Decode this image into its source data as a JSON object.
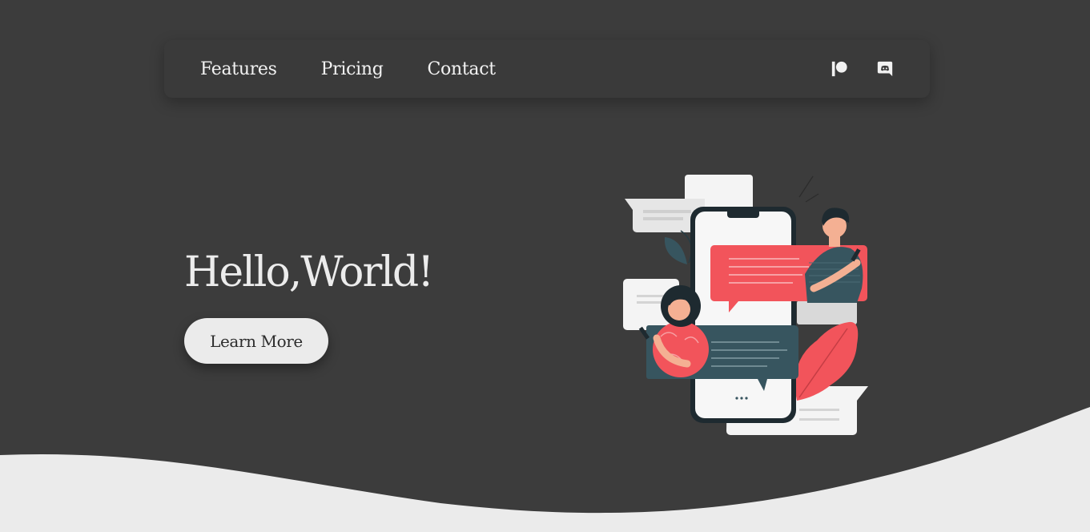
{
  "nav": {
    "links": [
      "Features",
      "Pricing",
      "Contact"
    ],
    "icons": [
      "patreon-icon",
      "discord-icon"
    ]
  },
  "hero": {
    "title": "Hello,World!",
    "cta_label": "Learn More"
  },
  "colors": {
    "background": "#3c3c3c",
    "nav_background": "#3a3a3a",
    "wave": "#ebebeb",
    "accent_red": "#f2545b",
    "accent_teal": "#37555f",
    "text_light": "#f2f2f2"
  }
}
